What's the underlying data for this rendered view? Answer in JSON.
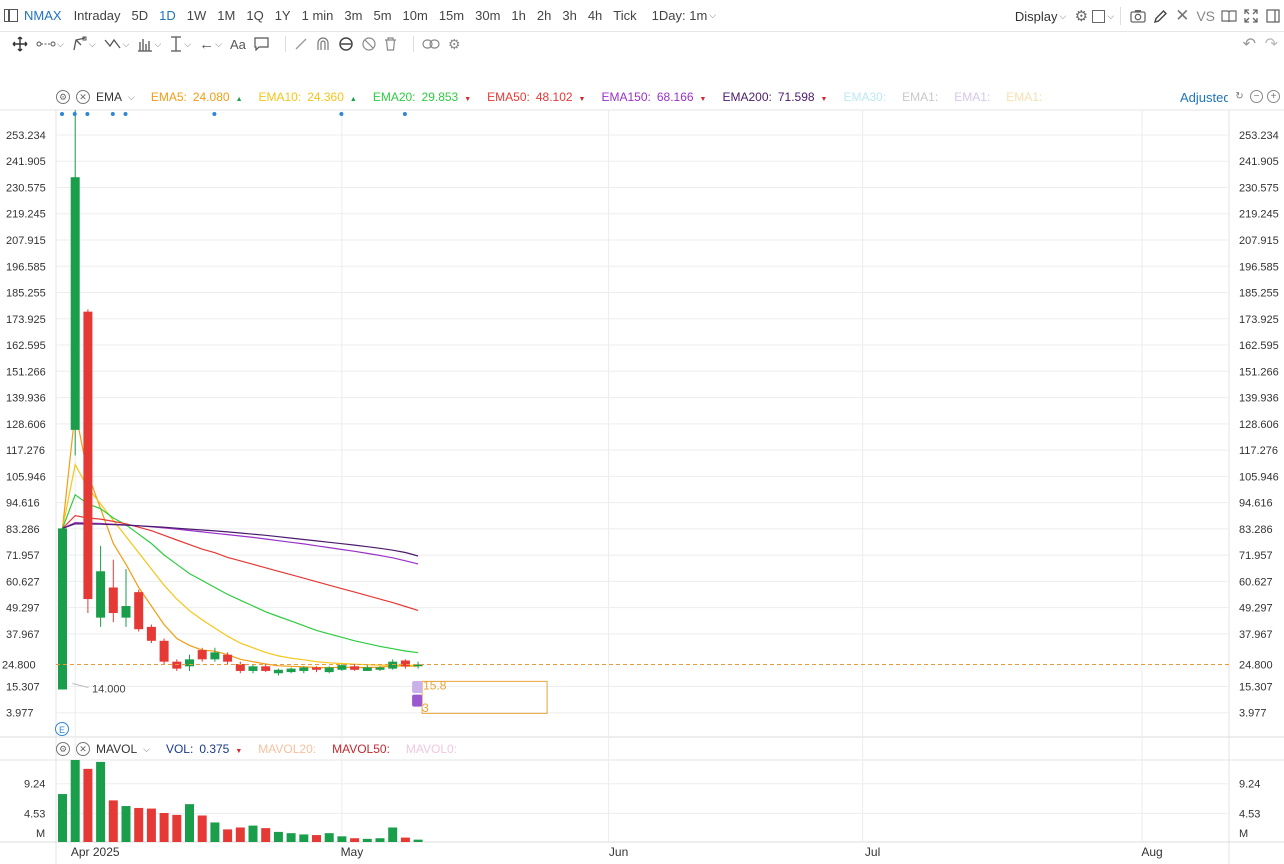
{
  "toolbar": {
    "symbol": "NMAX",
    "timeframes": [
      "Intraday",
      "5D",
      "1D",
      "1W",
      "1M",
      "1Q",
      "1Y",
      "1 min",
      "3m",
      "5m",
      "10m",
      "15m",
      "30m",
      "1h",
      "2h",
      "3h",
      "4h",
      "Tick"
    ],
    "active_timeframe": "1D",
    "interval_select": "1Day: 1m",
    "display_label": "Display",
    "vs_label": "VS"
  },
  "main_legend": {
    "indicator": "EMA",
    "items": [
      {
        "label": "EMA5:",
        "value": "24.080",
        "color": "#f39c12",
        "dir": "up"
      },
      {
        "label": "EMA10:",
        "value": "24.360",
        "color": "#f5c518",
        "dir": "up"
      },
      {
        "label": "EMA20:",
        "value": "29.853",
        "color": "#2ecc40",
        "dir": "down"
      },
      {
        "label": "EMA50:",
        "value": "48.102",
        "color": "#e53935",
        "dir": "down"
      },
      {
        "label": "EMA150:",
        "value": "68.166",
        "color": "#9b30c8",
        "dir": "down"
      },
      {
        "label": "EMA200:",
        "value": "71.598",
        "color": "#4a1a6b",
        "dir": "down"
      },
      {
        "label": "EMA30:",
        "value": "",
        "color": "#bde8f5",
        "dir": ""
      },
      {
        "label": "EMA1:",
        "value": "",
        "color": "#c8c8c8",
        "dir": ""
      },
      {
        "label": "EMA1:",
        "value": "",
        "color": "#d5c8e8",
        "dir": ""
      },
      {
        "label": "EMA1:",
        "value": "",
        "color": "#f5e0b0",
        "dir": ""
      }
    ],
    "adjusted_label": "Adjusted"
  },
  "volume_legend": {
    "indicator": "MAVOL",
    "items": [
      {
        "label": "VOL:",
        "value": "0.375",
        "color": "#1a3a8a",
        "dir": "down"
      },
      {
        "label": "MAVOL20:",
        "value": "",
        "color": "#f5c0a0",
        "dir": ""
      },
      {
        "label": "MAVOL50:",
        "value": "",
        "color": "#c0282e",
        "dir": ""
      },
      {
        "label": "MAVOL0:",
        "value": "",
        "color": "#f0c8e0",
        "dir": ""
      }
    ]
  },
  "chart_data": {
    "type": "candlestick",
    "y_ticks": [
      "253.234",
      "241.905",
      "230.575",
      "219.245",
      "207.915",
      "196.585",
      "185.255",
      "173.925",
      "162.595",
      "151.266",
      "139.936",
      "128.606",
      "117.276",
      "105.946",
      "94.616",
      "83.286",
      "71.957",
      "60.627",
      "49.297",
      "37.967",
      "15.307",
      "3.977"
    ],
    "ylim": [
      -6.5,
      264
    ],
    "last_price": "24.800",
    "low_marker": "14.000",
    "order_marker_value": "15.8",
    "order_marker_qty": "3",
    "x_labels": [
      {
        "label": "Apr 2025",
        "index": 1
      },
      {
        "label": "May",
        "index": 22
      },
      {
        "label": "Jun",
        "index": 43
      },
      {
        "label": "Jul",
        "index": 63
      },
      {
        "label": "Aug",
        "index": 85
      }
    ],
    "candles": [
      {
        "o": 14.0,
        "h": 84.0,
        "l": 14.0,
        "c": 83.5,
        "up": true
      },
      {
        "o": 126.0,
        "h": 264.0,
        "l": 115.0,
        "c": 235.0,
        "up": true
      },
      {
        "o": 177.0,
        "h": 178.0,
        "l": 47.0,
        "c": 53.0,
        "up": false
      },
      {
        "o": 45.0,
        "h": 76.0,
        "l": 41.0,
        "c": 65.0,
        "up": true
      },
      {
        "o": 58.0,
        "h": 70.0,
        "l": 43.0,
        "c": 47.0,
        "up": false
      },
      {
        "o": 45.0,
        "h": 66.0,
        "l": 41.0,
        "c": 50.0,
        "up": true
      },
      {
        "o": 56.0,
        "h": 57.0,
        "l": 39.0,
        "c": 40.0,
        "up": false
      },
      {
        "o": 41.0,
        "h": 42.0,
        "l": 34.0,
        "c": 35.0,
        "up": false
      },
      {
        "o": 35.0,
        "h": 36.0,
        "l": 25.0,
        "c": 26.0,
        "up": false
      },
      {
        "o": 26.0,
        "h": 27.0,
        "l": 22.0,
        "c": 23.0,
        "up": false
      },
      {
        "o": 24.0,
        "h": 29.0,
        "l": 22.0,
        "c": 27.0,
        "up": true
      },
      {
        "o": 31.0,
        "h": 32.0,
        "l": 26.0,
        "c": 27.0,
        "up": false
      },
      {
        "o": 27.0,
        "h": 32.0,
        "l": 26.0,
        "c": 30.0,
        "up": true
      },
      {
        "o": 29.0,
        "h": 30.0,
        "l": 25.0,
        "c": 26.0,
        "up": false
      },
      {
        "o": 25.0,
        "h": 26.0,
        "l": 21.0,
        "c": 22.0,
        "up": false
      },
      {
        "o": 22.0,
        "h": 25.0,
        "l": 21.0,
        "c": 24.0,
        "up": true
      },
      {
        "o": 24.0,
        "h": 25.0,
        "l": 21.5,
        "c": 22.0,
        "up": false
      },
      {
        "o": 21.0,
        "h": 23.0,
        "l": 20.0,
        "c": 22.5,
        "up": true
      },
      {
        "o": 21.5,
        "h": 23.5,
        "l": 21.0,
        "c": 23.0,
        "up": true
      },
      {
        "o": 22.0,
        "h": 24.0,
        "l": 21.0,
        "c": 23.5,
        "up": true
      },
      {
        "o": 23.5,
        "h": 24.0,
        "l": 21.5,
        "c": 22.5,
        "up": false
      },
      {
        "o": 21.5,
        "h": 24.0,
        "l": 21.0,
        "c": 23.5,
        "up": true
      },
      {
        "o": 22.5,
        "h": 25.0,
        "l": 22.0,
        "c": 24.5,
        "up": true
      },
      {
        "o": 24.0,
        "h": 25.0,
        "l": 22.0,
        "c": 22.5,
        "up": false
      },
      {
        "o": 22.0,
        "h": 24.5,
        "l": 22.0,
        "c": 23.5,
        "up": true
      },
      {
        "o": 22.5,
        "h": 24.0,
        "l": 22.0,
        "c": 23.5,
        "up": true
      },
      {
        "o": 23.0,
        "h": 27.0,
        "l": 22.5,
        "c": 26.0,
        "up": true
      },
      {
        "o": 26.5,
        "h": 27.0,
        "l": 23.0,
        "c": 24.0,
        "up": false
      },
      {
        "o": 24.0,
        "h": 26.0,
        "l": 23.0,
        "c": 24.8,
        "up": true
      }
    ],
    "ema_series": [
      {
        "name": "EMA5",
        "color": "#f39c12",
        "values": [
          83.5,
          134,
          107,
          92,
          77,
          68,
          58,
          50,
          42,
          36,
          33,
          31,
          30.5,
          29,
          27,
          26,
          25,
          24.2,
          24,
          23.8,
          23.5,
          23.4,
          23.6,
          23.5,
          23.5,
          23.6,
          24.2,
          24.1,
          24.08
        ]
      },
      {
        "name": "EMA10",
        "color": "#f5c518",
        "values": [
          83.5,
          111,
          101,
          94,
          87,
          80,
          73,
          66,
          59,
          53,
          48,
          44,
          40.5,
          37,
          34,
          32,
          30,
          28.5,
          27.5,
          26.8,
          26,
          25.5,
          25.2,
          24.9,
          24.7,
          24.5,
          24.5,
          24.4,
          24.36
        ]
      },
      {
        "name": "EMA20",
        "color": "#2ecc40",
        "values": [
          83.5,
          98,
          94,
          92,
          88,
          85,
          81,
          77,
          72,
          68,
          64,
          61,
          58,
          55,
          52.5,
          50,
          47.5,
          45.5,
          43.5,
          41.5,
          39.5,
          38,
          36.5,
          35,
          33.8,
          32.6,
          31.6,
          30.6,
          29.85
        ]
      },
      {
        "name": "EMA50",
        "color": "#e53935",
        "values": [
          83.5,
          89,
          88,
          87.5,
          86.5,
          85.5,
          84,
          82.5,
          80.5,
          78.5,
          76.5,
          74.5,
          73,
          71,
          69.5,
          68,
          66.5,
          65,
          63.5,
          62,
          60.5,
          59,
          57.5,
          56,
          54.5,
          53,
          51.5,
          49.8,
          48.1
        ]
      },
      {
        "name": "EMA150",
        "color": "#9b30c8",
        "values": [
          83.5,
          86,
          85.8,
          85.6,
          85.3,
          85,
          84.6,
          84.2,
          83.7,
          83.2,
          82.6,
          82,
          81.4,
          80.8,
          80.2,
          79.6,
          78.9,
          78.2,
          77.5,
          76.8,
          76,
          75.2,
          74.4,
          73.6,
          72.7,
          71.8,
          70.8,
          69.5,
          68.17
        ]
      },
      {
        "name": "EMA200",
        "color": "#4a1a6b",
        "values": [
          83.5,
          85.5,
          85.4,
          85.3,
          85.1,
          84.9,
          84.6,
          84.3,
          84,
          83.6,
          83.2,
          82.8,
          82.4,
          82,
          81.5,
          81,
          80.5,
          79.9,
          79.3,
          78.7,
          78.1,
          77.5,
          76.9,
          76.3,
          75.6,
          74.9,
          74.1,
          73.1,
          71.6
        ]
      }
    ],
    "volume": {
      "y_ticks": [
        "9.24",
        "4.53",
        "M"
      ],
      "ylim": [
        0,
        13
      ],
      "values": [
        7.6,
        13.0,
        11.6,
        12.7,
        6.6,
        5.7,
        5.4,
        5.3,
        4.6,
        4.3,
        6.0,
        4.2,
        3.1,
        2.0,
        2.3,
        2.6,
        2.2,
        1.6,
        1.4,
        1.2,
        1.1,
        1.4,
        0.9,
        0.6,
        0.5,
        0.6,
        2.3,
        0.7,
        0.375
      ],
      "up": [
        true,
        true,
        false,
        true,
        false,
        true,
        false,
        false,
        false,
        false,
        true,
        false,
        true,
        false,
        false,
        true,
        false,
        true,
        true,
        true,
        false,
        true,
        true,
        false,
        true,
        true,
        true,
        false,
        true
      ]
    }
  }
}
